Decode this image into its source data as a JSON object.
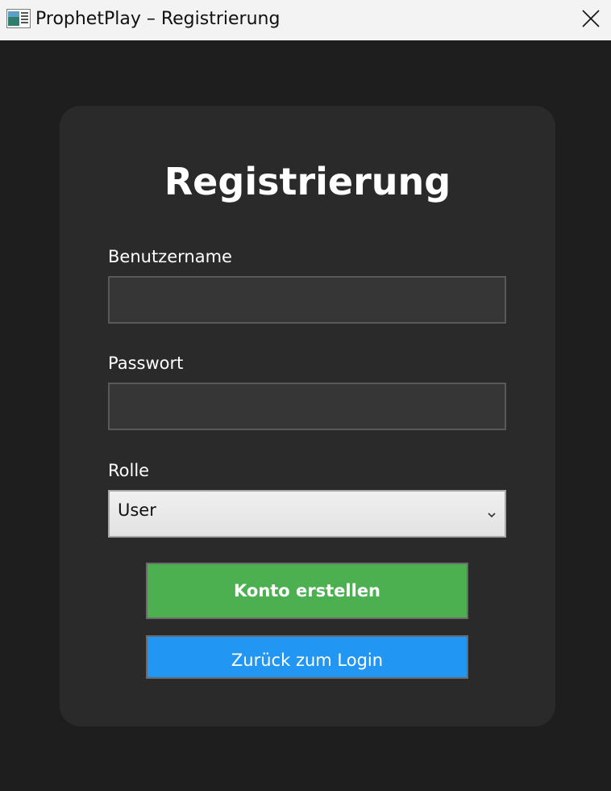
{
  "window": {
    "title": "ProphetPlay – Registrierung",
    "app_icon": "app-window-icon",
    "close_icon": "close-icon"
  },
  "form": {
    "heading": "Registrierung",
    "username": {
      "label": "Benutzername",
      "value": ""
    },
    "password": {
      "label": "Passwort",
      "value": ""
    },
    "role": {
      "label": "Rolle",
      "selected": "User",
      "chevron_icon": "chevron-down-icon"
    },
    "create_button": "Konto erstellen",
    "back_button": "Zurück zum Login"
  },
  "colors": {
    "background": "#1e1e1e",
    "card": "#2a2a2a",
    "input": "#363636",
    "create_button": "#4caf50",
    "back_button": "#2196f3"
  }
}
